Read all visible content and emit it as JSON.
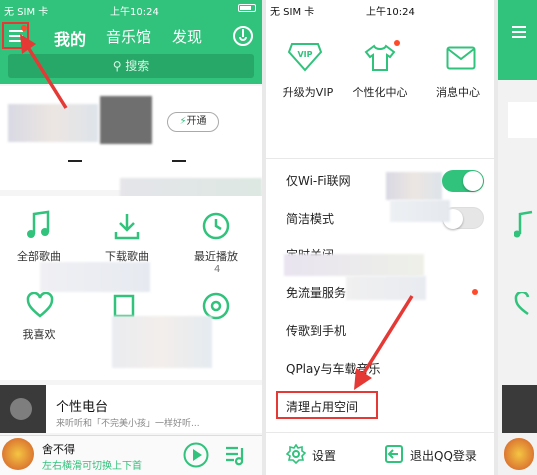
{
  "colors": {
    "brand": "#31c27c",
    "accent_red": "#e53935"
  },
  "left": {
    "status": {
      "carrier": "无 SIM 卡",
      "time": "上午10:24"
    },
    "tabs": [
      {
        "label": "我的"
      },
      {
        "label": "音乐馆"
      },
      {
        "label": "发现"
      }
    ],
    "search_placeholder": "搜索",
    "open_vip_label": "开通",
    "grid": [
      {
        "label": "全部歌曲",
        "icon": "music-note-icon"
      },
      {
        "label": "下载歌曲",
        "icon": "download-icon"
      },
      {
        "label": "最近播放",
        "icon": "clock-icon",
        "count": "4"
      },
      {
        "label": "我喜欢",
        "icon": "heart-icon"
      },
      {
        "label": "",
        "icon": "folder-icon"
      },
      {
        "label": "",
        "icon": "disc-icon"
      }
    ],
    "radio": {
      "title": "个性电台",
      "subtitle": "来听听和「不完美小孩」一样好听..."
    },
    "player": {
      "title": "舍不得",
      "hint": "左右横滑可切换上下首"
    }
  },
  "right": {
    "status": {
      "carrier": "无 SIM 卡",
      "time": "上午10:24"
    },
    "top_icons": [
      {
        "label": "升级为VIP",
        "icon": "vip-diamond-icon"
      },
      {
        "label": "个性化中心",
        "icon": "tshirt-icon"
      },
      {
        "label": "消息中心",
        "icon": "envelope-icon"
      }
    ],
    "items": [
      {
        "label": "仅Wi-Fi联网"
      },
      {
        "label": "简洁模式"
      },
      {
        "label": "定时关闭"
      },
      {
        "label": "免流量服务"
      },
      {
        "label": "传歌到手机"
      },
      {
        "label": "QPlay与车载音乐"
      },
      {
        "label": "清理占用空间"
      }
    ],
    "settings_label": "设置",
    "logout_label": "退出QQ登录"
  }
}
